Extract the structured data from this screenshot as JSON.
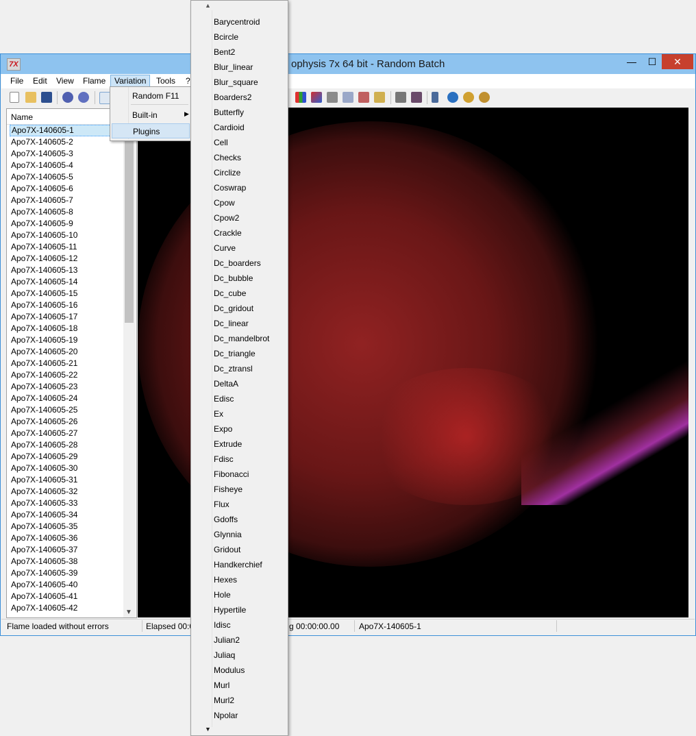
{
  "window": {
    "title": "ophysis 7x 64 bit - Random Batch",
    "icon_label": "7X",
    "min_glyph": "—",
    "max_glyph": "☐",
    "close_glyph": "✕"
  },
  "menubar": [
    "File",
    "Edit",
    "View",
    "Flame",
    "Variation",
    "Tools",
    "?"
  ],
  "list": {
    "header": "Name",
    "rows": [
      "Apo7X-140605-1",
      "Apo7X-140605-2",
      "Apo7X-140605-3",
      "Apo7X-140605-4",
      "Apo7X-140605-5",
      "Apo7X-140605-6",
      "Apo7X-140605-7",
      "Apo7X-140605-8",
      "Apo7X-140605-9",
      "Apo7X-140605-10",
      "Apo7X-140605-11",
      "Apo7X-140605-12",
      "Apo7X-140605-13",
      "Apo7X-140605-14",
      "Apo7X-140605-15",
      "Apo7X-140605-16",
      "Apo7X-140605-17",
      "Apo7X-140605-18",
      "Apo7X-140605-19",
      "Apo7X-140605-20",
      "Apo7X-140605-21",
      "Apo7X-140605-22",
      "Apo7X-140605-23",
      "Apo7X-140605-24",
      "Apo7X-140605-25",
      "Apo7X-140605-26",
      "Apo7X-140605-27",
      "Apo7X-140605-28",
      "Apo7X-140605-29",
      "Apo7X-140605-30",
      "Apo7X-140605-31",
      "Apo7X-140605-32",
      "Apo7X-140605-33",
      "Apo7X-140605-34",
      "Apo7X-140605-35",
      "Apo7X-140605-36",
      "Apo7X-140605-37",
      "Apo7X-140605-38",
      "Apo7X-140605-39",
      "Apo7X-140605-40",
      "Apo7X-140605-41",
      "Apo7X-140605-42"
    ],
    "selected_index": 0
  },
  "variation_menu": {
    "random": "Random F11",
    "builtin": "Built-in",
    "plugins": "Plugins"
  },
  "plugins": [
    "Barycentroid",
    "Bcircle",
    "Bent2",
    "Blur_linear",
    "Blur_square",
    "Boarders2",
    "Butterfly",
    "Cardioid",
    "Cell",
    "Checks",
    "Circlize",
    "Coswrap",
    "Cpow",
    "Cpow2",
    "Crackle",
    "Curve",
    "Dc_boarders",
    "Dc_bubble",
    "Dc_cube",
    "Dc_gridout",
    "Dc_linear",
    "Dc_mandelbrot",
    "Dc_triangle",
    "Dc_ztransl",
    "DeltaA",
    "Edisc",
    "Ex",
    "Expo",
    "Extrude",
    "Fdisc",
    "Fibonacci",
    "Fisheye",
    "Flux",
    "Gdoffs",
    "Glynnia",
    "Gridout",
    "Handkerchief",
    "Hexes",
    "Hole",
    "Hypertile",
    "Idisc",
    "Julian2",
    "Juliaq",
    "Modulus",
    "Murl",
    "Murl2",
    "Npolar"
  ],
  "status": {
    "message": "Flame loaded without errors",
    "elapsed": "Elapsed 00:0",
    "remaining": "g 00:00:00.00",
    "flame_name": "Apo7X-140605-1"
  },
  "colors": {
    "titlebar": "#8ec3ef",
    "close": "#c7402d",
    "selection": "#cde8f7",
    "canvas": "#000000"
  },
  "toolbar_icons": [
    "new-icon",
    "open-icon",
    "save-icon",
    "render-icon",
    "batch-render-icon",
    "list-view-icon",
    "palette-icon",
    "gradient-icon",
    "grid-icon",
    "layers-icon",
    "edit-icon",
    "options-icon",
    "fullscreen-icon",
    "frame-icon",
    "pointer-icon",
    "rotate-icon",
    "zoom-in-icon",
    "zoom-out-icon"
  ]
}
